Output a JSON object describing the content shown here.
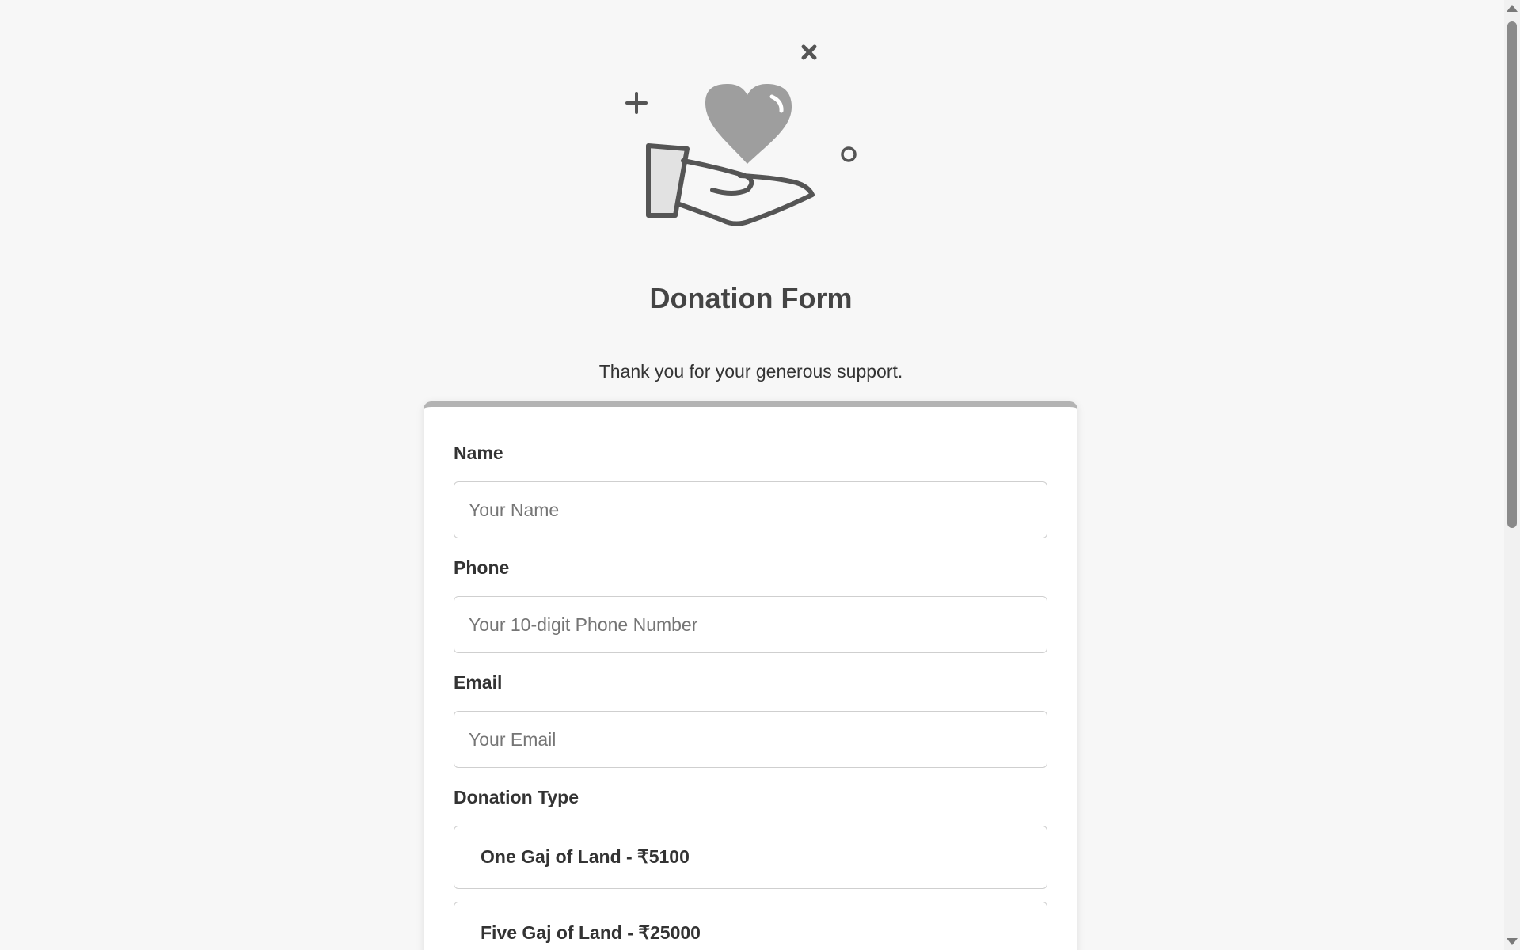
{
  "header": {
    "title": "Donation Form",
    "subtitle": "Thank you for your generous support."
  },
  "hero_icon": "hand-holding-heart-icon",
  "form": {
    "name": {
      "label": "Name",
      "placeholder": "Your Name"
    },
    "phone": {
      "label": "Phone",
      "placeholder": "Your 10-digit Phone Number"
    },
    "email": {
      "label": "Email",
      "placeholder": "Your Email"
    },
    "donation_type": {
      "label": "Donation Type",
      "options": [
        {
          "label": "One Gaj of Land - ₹5100"
        },
        {
          "label": "Five Gaj of Land - ₹25000"
        }
      ]
    }
  },
  "colors": {
    "background": "#f7f7f7",
    "card": "#ffffff",
    "card_accent": "#b3b3b3",
    "text": "#333333",
    "heart": "#9e9e9e",
    "icon_stroke": "#555555"
  }
}
